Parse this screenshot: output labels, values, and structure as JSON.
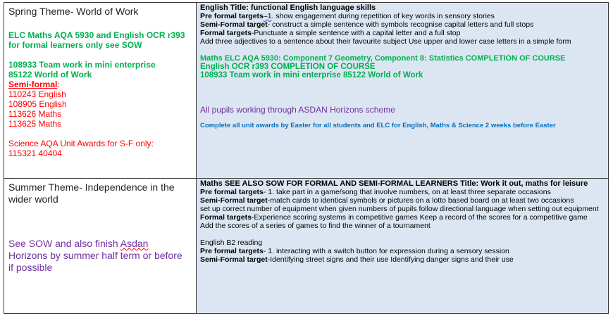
{
  "spring": {
    "theme": "Spring Theme- World of Work",
    "elc_line": "ELC Maths AQA 5930 and English OCR r393 for formal learners only see SOW",
    "teamwork": "108933 Team work in mini enterprise",
    "world_of_work": "85122 World of Work",
    "semi_formal_heading": "Semi-formal",
    "semi_formal_colon": ":",
    "semi_formal_units": [
      "110243 English",
      "108905 English",
      "113626 Maths",
      "113625 Maths"
    ],
    "science_line": "Science AQA Unit Awards for S-F only:",
    "science_codes": "115321  40404",
    "english_title": "English   Title: functional English language skills",
    "pre_formal_label": "Pre formal targets",
    "pre_formal_squiggle": "–1",
    "pre_formal_text": ". show engagement during repetition of key words in sensory stories",
    "semi_formal_label": "Semi-Formal target",
    "semi_formal_text": "- construct a simple sentence with symbols  recognise capital letters and full stops",
    "formal_label": "Formal targets",
    "formal_text": "-Punctuate a simple sentence with a capital letter and a full stop",
    "adjectives": "Add three adjectives to a sentence about their favourite subject    Use upper and lower case letters in a simple form",
    "maths_elc": "Maths ELC AQA 5930:  Component 7 Geometry, Component 8: Statistics COMPLETION OF COURSE",
    "english_ocr": "English OCR r393  COMPLETION OF COURSE",
    "teamwork_right": "108933 Team work in mini enterprise    85122 World of Work",
    "asdan_pupils": "All pupils working through ASDAN Horizons scheme",
    "complete_awards": "Complete all unit awards by Easter for all students and ELC for English, Maths & Science 2 weeks before Easter"
  },
  "summer": {
    "theme": "Summer Theme- Independence in the wider world",
    "sow_before": "See SOW and also finish ",
    "sow_asdan": "Asdan",
    "sow_after": " Horizons by summer half term or before if possible",
    "maths_title": "Maths      SEE ALSO SOW FOR FORMAL AND SEMI-FORMAL LEARNERS    Title: Work it out, maths for leisure",
    "pre_formal_label": "Pre formal targets",
    "pre_formal_text": "- 1. take part in a game/song that involve numbers, on at least three separate occasions",
    "semi_formal_label": "Semi-Formal target",
    "semi_formal_text": "-match cards to identical symbols or pictures on a lotto based board on at least two occasions",
    "equipment": "set up correct number of equipment when given numbers of pupils   follow directional language when setting out equipment",
    "formal_label": "Formal targets",
    "formal_text": "-Experience scoring systems in competitive games Keep a record of the scores for a competitive game",
    "scores": "Add the scores of a series of games to find the winner of a tournament",
    "english_b2": "English B2 reading",
    "pre_formal2_label": "Pre formal targets",
    "pre_formal2_text": "- 1. interacting with a switch button for expression during a sensory session",
    "semi_formal2_label": "Semi-Formal target",
    "semi_formal2_text": "-Identifying street signs and their use  Identifying danger signs and their use"
  }
}
